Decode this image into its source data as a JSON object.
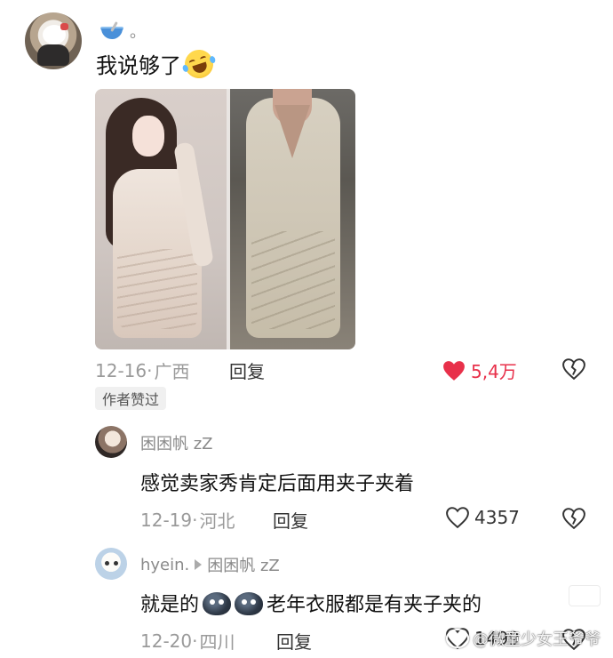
{
  "main_comment": {
    "username": "。",
    "text": "我说够了",
    "date": "12-16",
    "location": "广西",
    "reply_label": "回复",
    "likes": "5,4万",
    "author_badge": "作者赞过",
    "colors": {
      "heart": "#e8304a"
    }
  },
  "replies": [
    {
      "username": "困困帆 zZ",
      "text": "感觉卖家秀肯定后面用夹子夹着",
      "date": "12-19",
      "location": "河北",
      "reply_label": "回复",
      "likes": "4357"
    },
    {
      "username": "hyein.",
      "reply_to": "困困帆 zZ",
      "text_start": "就是的",
      "text_end": "老年衣服都是有夹子夹的",
      "date": "12-20",
      "location": "四川",
      "reply_label": "回复",
      "likes": "1499"
    }
  ],
  "watermark": {
    "text": "@微童少女王爷爷"
  }
}
